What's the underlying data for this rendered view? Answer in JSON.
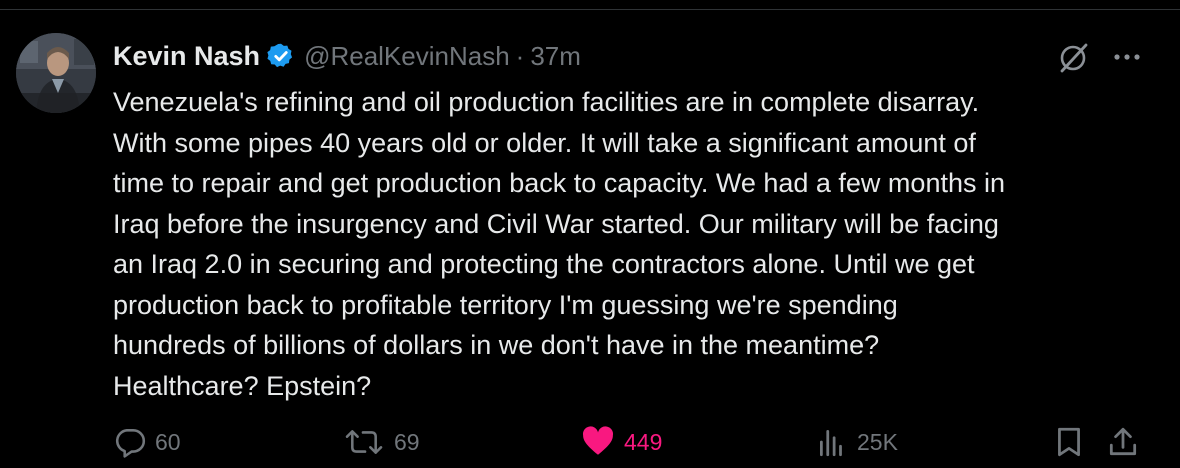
{
  "author": {
    "name": "Kevin Nash",
    "handle": "@RealKevinNash",
    "separator": "·",
    "time": "37m"
  },
  "tweet": {
    "text": "Venezuela's refining and oil production facilities are in complete disarray.\nWith some pipes 40 years old or older. It will take a significant amount of\ntime to repair and get production back to capacity. We had a few months in\nIraq before the insurgency and Civil War started.  Our military will be facing\nan Iraq 2.0 in securing and protecting the contractors alone. Until we get\nproduction back to profitable territory I'm guessing we're spending\nhundreds of billions of dollars in we don't have in the meantime?\nHealthcare? Epstein?"
  },
  "actions": {
    "reply_count": "60",
    "retweet_count": "69",
    "like_count": "449",
    "view_count": "25K"
  },
  "icons": {
    "verified": "verified-badge-icon",
    "grok": "grok-icon",
    "more": "more-icon",
    "reply": "reply-icon",
    "retweet": "retweet-icon",
    "like": "heart-icon",
    "views": "views-icon",
    "bookmark": "bookmark-icon",
    "share": "share-icon"
  },
  "colors": {
    "background": "#000000",
    "text": "#e7e9ea",
    "muted": "#71767b",
    "verified": "#1d9bf0",
    "like": "#f91880"
  }
}
